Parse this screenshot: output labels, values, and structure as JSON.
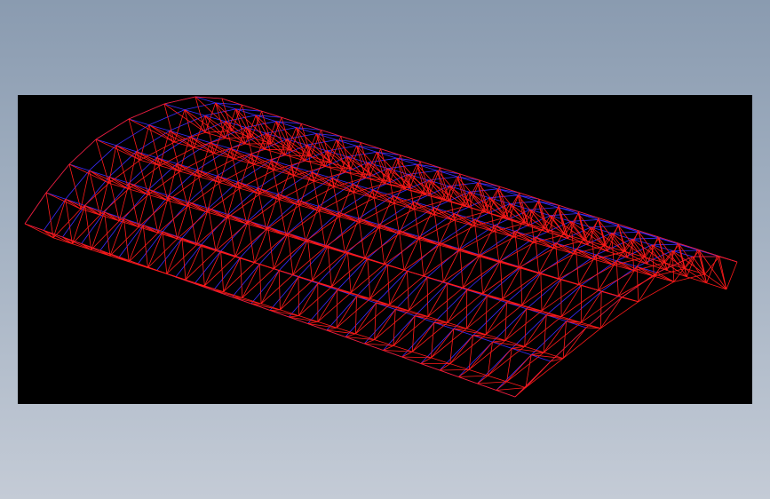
{
  "viewer": {
    "background_color": "#000000",
    "backdrop_top_color": "#8a9bb0",
    "backdrop_bottom_color": "#c4cbd6"
  },
  "model": {
    "kind": "space-truss-barrel-vault",
    "render_mode": "wireframe",
    "chord_color": "#3a2cff",
    "web_color": "#ff1a1a",
    "longitudinal_modules": 26,
    "arc_modules": 7
  }
}
